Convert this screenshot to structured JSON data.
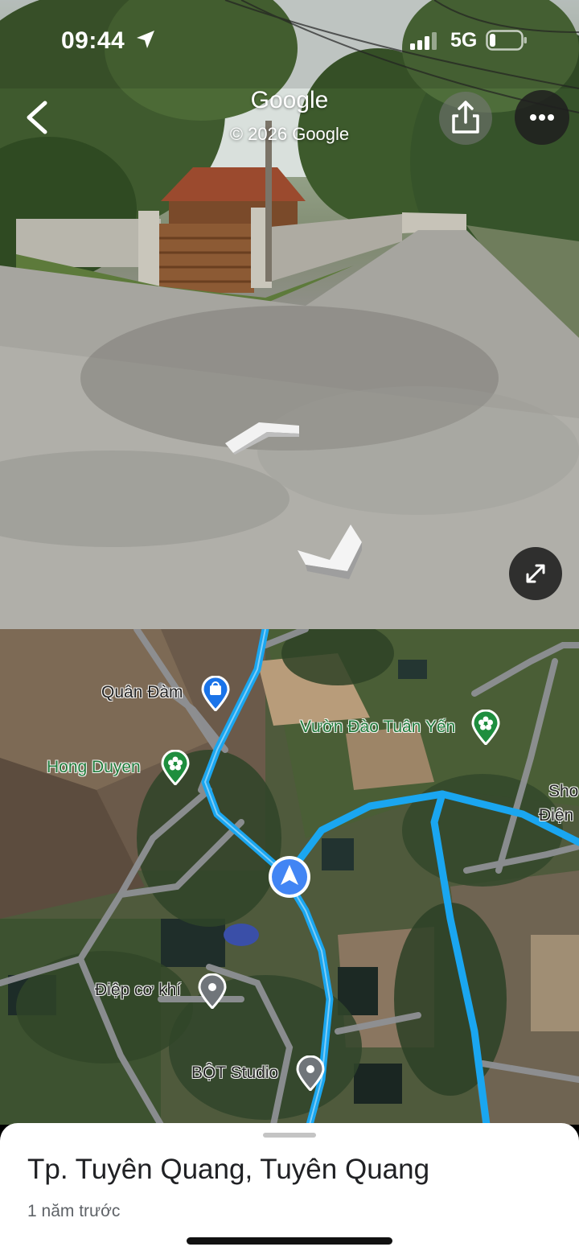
{
  "status_bar": {
    "time": "09:44",
    "network": "5G",
    "location_icon": "location-arrow-icon",
    "signal_icon": "cellular-signal-icon",
    "battery_icon": "battery-low-icon"
  },
  "street_view": {
    "title": "Google",
    "copyright": "© 2026 Google",
    "back_icon": "chevron-left-icon",
    "share_icon": "share-icon",
    "more_icon": "more-horizontal-icon",
    "expand_icon": "expand-icon"
  },
  "map": {
    "route_color": "#1aa6f0",
    "pois": [
      {
        "name": "Quân Đàm",
        "icon": "shopping-bag-icon",
        "style": "dark"
      },
      {
        "name": "Vườn Đào Tuân Yến",
        "icon": "flower-icon",
        "style": "green"
      },
      {
        "name": "Hong Duyen",
        "icon": "flower-icon",
        "style": "green"
      },
      {
        "name": "Điệp cơ khí",
        "icon": "place-pin-icon",
        "style": "dark"
      },
      {
        "name": "BỘT Studio",
        "icon": "place-pin-icon",
        "style": "dark"
      },
      {
        "name": "Sho",
        "icon": "",
        "style": "dark"
      },
      {
        "name": "Điện",
        "icon": "",
        "style": "dark"
      }
    ],
    "current_location_icon": "navigation-arrow-icon"
  },
  "sheet": {
    "title": "Tp. Tuyên Quang, Tuyên Quang",
    "subtitle": "1 năm trước"
  }
}
